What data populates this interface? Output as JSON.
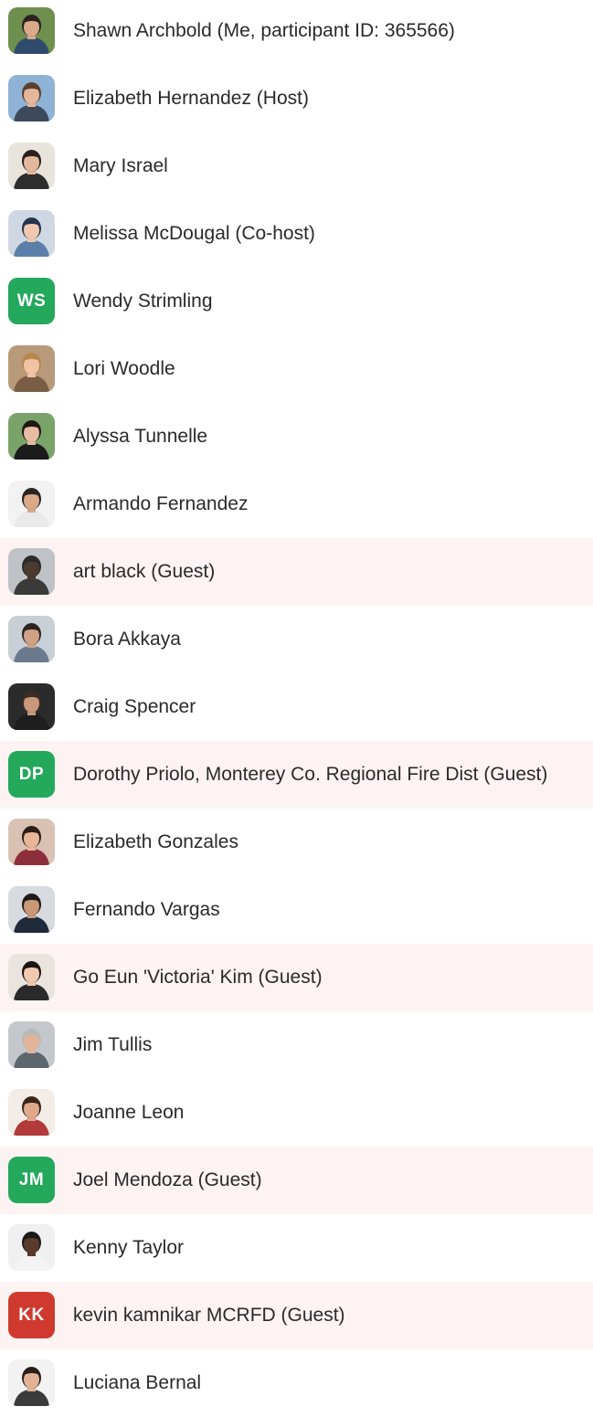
{
  "participants": [
    {
      "name": "Shawn Archbold (Me, participant ID: 365566)",
      "avatar": {
        "type": "photo",
        "bg": "#6f8f4e",
        "hair": "#2a2320",
        "skin": "#d9a98a",
        "shirt": "#2f4b6b"
      },
      "guest": false
    },
    {
      "name": "Elizabeth Hernandez (Host)",
      "avatar": {
        "type": "photo",
        "bg": "#8fb3d6",
        "hair": "#5a4030",
        "skin": "#e3b79c",
        "shirt": "#3c4a5c"
      },
      "guest": false
    },
    {
      "name": "Mary Israel",
      "avatar": {
        "type": "photo",
        "bg": "#e8e4dc",
        "hair": "#2b201b",
        "skin": "#e2b89c",
        "shirt": "#2d2d2d"
      },
      "guest": false
    },
    {
      "name": "Melissa McDougal (Co-host)",
      "avatar": {
        "type": "photo",
        "bg": "#cfd8e2",
        "hair": "#27354d",
        "skin": "#f0c8b2",
        "shirt": "#5b7fa8"
      },
      "guest": false
    },
    {
      "name": "Wendy Strimling",
      "avatar": {
        "type": "initials",
        "text": "WS",
        "bg": "#23a85c"
      },
      "guest": false
    },
    {
      "name": "Lori Woodle",
      "avatar": {
        "type": "photo",
        "bg": "#b89a7a",
        "hair": "#b8864f",
        "skin": "#efc3a3",
        "shirt": "#7a5d44"
      },
      "guest": false
    },
    {
      "name": "Alyssa Tunnelle",
      "avatar": {
        "type": "photo",
        "bg": "#7aa36a",
        "hair": "#1f1815",
        "skin": "#e6bca2",
        "shirt": "#1b1b1b"
      },
      "guest": false
    },
    {
      "name": "Armando Fernandez",
      "avatar": {
        "type": "photo",
        "bg": "#f2f2f2",
        "hair": "#2a2420",
        "skin": "#d9a98a",
        "shirt": "#e9e9e9"
      },
      "guest": false
    },
    {
      "name": "art black (Guest)",
      "avatar": {
        "type": "photo",
        "bg": "#bfc2c6",
        "hair": "#2b2b2b",
        "skin": "#4a3a30",
        "shirt": "#3a3a3a"
      },
      "guest": true
    },
    {
      "name": "Bora Akkaya",
      "avatar": {
        "type": "photo",
        "bg": "#c9cfd6",
        "hair": "#2a2420",
        "skin": "#cfa185",
        "shirt": "#6a7a8c"
      },
      "guest": false
    },
    {
      "name": "Craig Spencer",
      "avatar": {
        "type": "photo",
        "bg": "#2b2b2b",
        "hair": "#3a2d25",
        "skin": "#c9977a",
        "shirt": "#1e1e1e"
      },
      "guest": false
    },
    {
      "name": "Dorothy Priolo, Monterey Co. Regional Fire Dist (Guest)",
      "avatar": {
        "type": "initials",
        "text": "DP",
        "bg": "#23a85c"
      },
      "guest": true
    },
    {
      "name": "Elizabeth Gonzales",
      "avatar": {
        "type": "photo",
        "bg": "#d9c2b3",
        "hair": "#2b1e18",
        "skin": "#e8b79a",
        "shirt": "#8c2f3b"
      },
      "guest": false
    },
    {
      "name": "Fernando Vargas",
      "avatar": {
        "type": "photo",
        "bg": "#d7dbe0",
        "hair": "#1f1a17",
        "skin": "#c99878",
        "shirt": "#1f2a3a"
      },
      "guest": false
    },
    {
      "name": "Go Eun 'Victoria' Kim (Guest)",
      "avatar": {
        "type": "photo",
        "bg": "#e9e4de",
        "hair": "#1b1411",
        "skin": "#f0c9ae",
        "shirt": "#2a2a2a"
      },
      "guest": true
    },
    {
      "name": "Jim Tullis",
      "avatar": {
        "type": "photo",
        "bg": "#c4c8cc",
        "hair": "#b9b9b9",
        "skin": "#e2b59a",
        "shirt": "#5b6670"
      },
      "guest": false
    },
    {
      "name": "Joanne Leon",
      "avatar": {
        "type": "photo",
        "bg": "#f4ece6",
        "hair": "#3a251c",
        "skin": "#e0a98c",
        "shirt": "#b23a3a"
      },
      "guest": false
    },
    {
      "name": "Joel Mendoza (Guest)",
      "avatar": {
        "type": "initials",
        "text": "JM",
        "bg": "#23a85c"
      },
      "guest": true
    },
    {
      "name": "Kenny Taylor",
      "avatar": {
        "type": "photo",
        "bg": "#f0f0f0",
        "hair": "#1a1a1a",
        "skin": "#5a3b2b",
        "shirt": "#f4f4f4"
      },
      "guest": false
    },
    {
      "name": "kevin kamnikar MCRFD (Guest)",
      "avatar": {
        "type": "initials",
        "text": "KK",
        "bg": "#d03a2e"
      },
      "guest": true
    },
    {
      "name": "Luciana Bernal",
      "avatar": {
        "type": "photo",
        "bg": "#f2f2f2",
        "hair": "#2a1f1a",
        "skin": "#e2b296",
        "shirt": "#3b3b3b"
      },
      "guest": false
    }
  ]
}
